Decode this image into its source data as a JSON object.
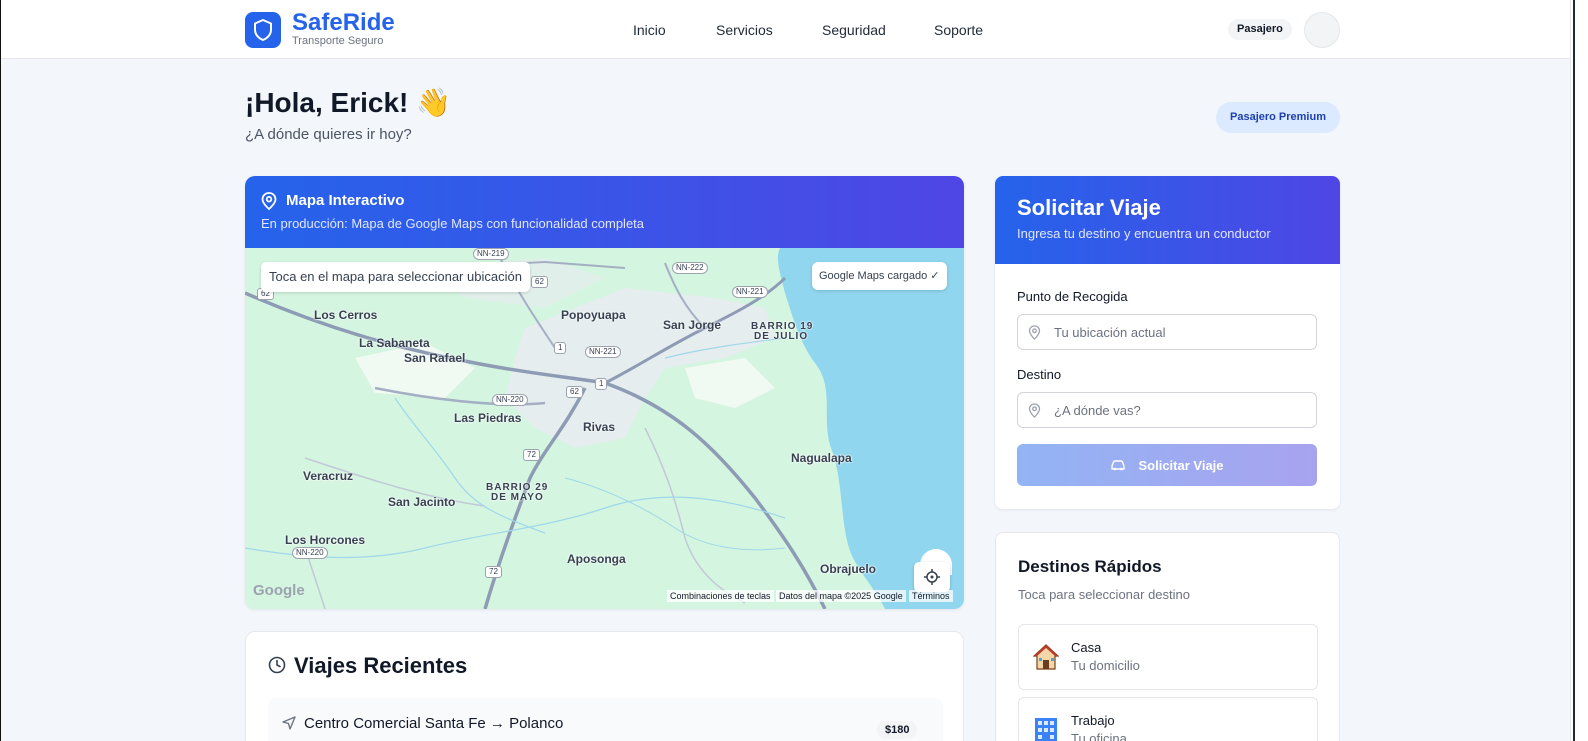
{
  "brand": {
    "name": "SafeRide",
    "tagline": "Transporte Seguro"
  },
  "nav": [
    "Inicio",
    "Servicios",
    "Seguridad",
    "Soporte"
  ],
  "user": {
    "role": "Pasajero"
  },
  "greeting": {
    "title": "¡Hola, Erick! 👋",
    "subtitle": "¿A dónde quieres ir hoy?",
    "badge": "Pasajero Premium"
  },
  "map": {
    "title": "Mapa Interactivo",
    "description": "En producción: Mapa de Google Maps con funcionalidad completa",
    "hint": "Toca en el mapa para seleccionar ubicación",
    "status": "Google Maps cargado ✓",
    "places": [
      "Los Cerros",
      "Popoyuapa",
      "San Jorge",
      "BARRIO 19",
      "DE JULIO",
      "La Sabaneta",
      "San Rafael",
      "Las Piedras",
      "Rivas",
      "Nagualapa",
      "Veracruz",
      "San Jacinto",
      "BARRIO 29",
      "DE MAYO",
      "Los Horcones",
      "Aposonga",
      "Obrajuelo"
    ],
    "shields": [
      "NN-219",
      "NN-222",
      "NN-221",
      "NN-221",
      "NN-220",
      "NN-220",
      "1",
      "1",
      "62",
      "72",
      "72",
      "62",
      "62"
    ],
    "attribution": {
      "shortcuts": "Combinaciones de teclas",
      "data": "Datos del mapa ©2025 Google",
      "terms": "Términos"
    },
    "logo": "Google"
  },
  "recent": {
    "title": "Viajes Recientes",
    "trips": [
      {
        "route": "Centro Comercial Santa Fe → Polanco",
        "price": "$180"
      }
    ]
  },
  "request": {
    "title": "Solicitar Viaje",
    "subtitle": "Ingresa tu destino y encuentra un conductor",
    "pickup_label": "Punto de Recogida",
    "pickup_placeholder": "Tu ubicación actual",
    "destination_label": "Destino",
    "destination_placeholder": "¿A dónde vas?",
    "button": "Solicitar Viaje"
  },
  "quick": {
    "title": "Destinos Rápidos",
    "subtitle": "Toca para seleccionar destino",
    "items": [
      {
        "name": "Casa",
        "desc": "Tu domicilio",
        "icon": "house-icon"
      },
      {
        "name": "Trabajo",
        "desc": "Tu oficina",
        "icon": "office-building-icon"
      }
    ]
  },
  "colors": {
    "primary": "#2563eb",
    "accent": "#4f46e5",
    "water": "#8fd6ee",
    "land": "#d4f5e0"
  }
}
